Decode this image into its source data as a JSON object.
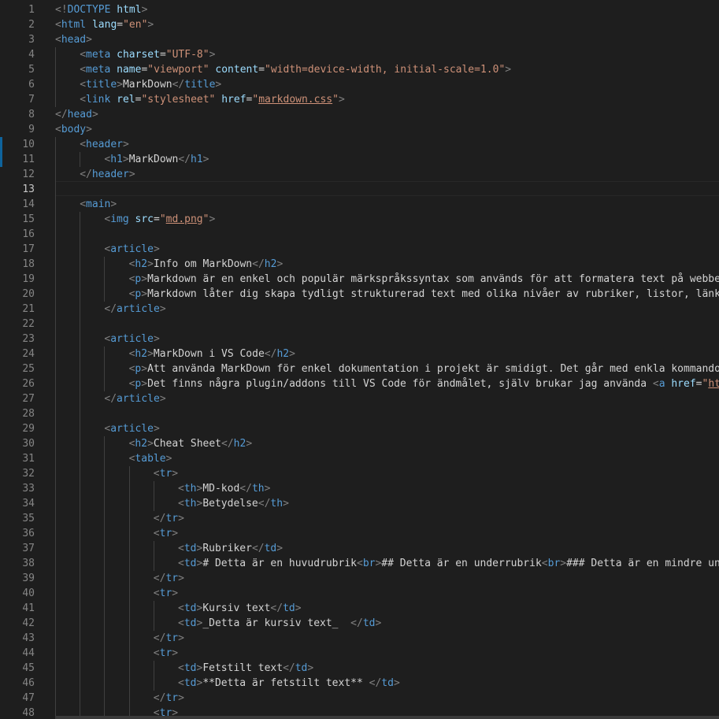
{
  "editor": {
    "language": "html",
    "active_line": 13,
    "lines": [
      {
        "n": 1,
        "indent": 0,
        "t": [
          [
            "bracket",
            "<!"
          ],
          [
            "tag",
            "DOCTYPE"
          ],
          [
            "txt",
            " "
          ],
          [
            "attr",
            "html"
          ],
          [
            "bracket",
            ">"
          ]
        ]
      },
      {
        "n": 2,
        "indent": 0,
        "t": [
          [
            "bracket",
            "<"
          ],
          [
            "tag",
            "html"
          ],
          [
            "txt",
            " "
          ],
          [
            "attr",
            "lang"
          ],
          [
            "eq",
            "="
          ],
          [
            "str",
            "\"en\""
          ],
          [
            "bracket",
            ">"
          ]
        ]
      },
      {
        "n": 3,
        "indent": 0,
        "t": [
          [
            "bracket",
            "<"
          ],
          [
            "tag",
            "head"
          ],
          [
            "bracket",
            ">"
          ]
        ]
      },
      {
        "n": 4,
        "indent": 1,
        "t": [
          [
            "bracket",
            "<"
          ],
          [
            "tag",
            "meta"
          ],
          [
            "txt",
            " "
          ],
          [
            "attr",
            "charset"
          ],
          [
            "eq",
            "="
          ],
          [
            "str",
            "\"UTF-8\""
          ],
          [
            "bracket",
            ">"
          ]
        ]
      },
      {
        "n": 5,
        "indent": 1,
        "t": [
          [
            "bracket",
            "<"
          ],
          [
            "tag",
            "meta"
          ],
          [
            "txt",
            " "
          ],
          [
            "attr",
            "name"
          ],
          [
            "eq",
            "="
          ],
          [
            "str",
            "\"viewport\""
          ],
          [
            "txt",
            " "
          ],
          [
            "attr",
            "content"
          ],
          [
            "eq",
            "="
          ],
          [
            "str",
            "\"width=device-width, initial-scale=1.0\""
          ],
          [
            "bracket",
            ">"
          ]
        ]
      },
      {
        "n": 6,
        "indent": 1,
        "t": [
          [
            "bracket",
            "<"
          ],
          [
            "tag",
            "title"
          ],
          [
            "bracket",
            ">"
          ],
          [
            "txt",
            "MarkDown"
          ],
          [
            "bracket",
            "</"
          ],
          [
            "tag",
            "title"
          ],
          [
            "bracket",
            ">"
          ]
        ]
      },
      {
        "n": 7,
        "indent": 1,
        "t": [
          [
            "bracket",
            "<"
          ],
          [
            "tag",
            "link"
          ],
          [
            "txt",
            " "
          ],
          [
            "attr",
            "rel"
          ],
          [
            "eq",
            "="
          ],
          [
            "str",
            "\"stylesheet\""
          ],
          [
            "txt",
            " "
          ],
          [
            "attr",
            "href"
          ],
          [
            "eq",
            "="
          ],
          [
            "str",
            "\""
          ],
          [
            "str lnk",
            "markdown.css"
          ],
          [
            "str",
            "\""
          ],
          [
            "bracket",
            ">"
          ]
        ]
      },
      {
        "n": 8,
        "indent": 0,
        "t": [
          [
            "bracket",
            "</"
          ],
          [
            "tag",
            "head"
          ],
          [
            "bracket",
            ">"
          ]
        ]
      },
      {
        "n": 9,
        "indent": 0,
        "t": [
          [
            "bracket",
            "<"
          ],
          [
            "tag",
            "body"
          ],
          [
            "bracket",
            ">"
          ]
        ]
      },
      {
        "n": 10,
        "indent": 1,
        "t": [
          [
            "bracket",
            "<"
          ],
          [
            "tag",
            "header"
          ],
          [
            "bracket",
            ">"
          ]
        ]
      },
      {
        "n": 11,
        "indent": 2,
        "t": [
          [
            "bracket",
            "<"
          ],
          [
            "tag",
            "h1"
          ],
          [
            "bracket",
            ">"
          ],
          [
            "txt",
            "MarkDown"
          ],
          [
            "bracket",
            "</"
          ],
          [
            "tag",
            "h1"
          ],
          [
            "bracket",
            ">"
          ]
        ]
      },
      {
        "n": 12,
        "indent": 1,
        "t": [
          [
            "bracket",
            "</"
          ],
          [
            "tag",
            "header"
          ],
          [
            "bracket",
            ">"
          ]
        ]
      },
      {
        "n": 13,
        "indent": 0,
        "t": []
      },
      {
        "n": 14,
        "indent": 1,
        "t": [
          [
            "bracket",
            "<"
          ],
          [
            "tag",
            "main"
          ],
          [
            "bracket",
            ">"
          ]
        ]
      },
      {
        "n": 15,
        "indent": 2,
        "t": [
          [
            "bracket",
            "<"
          ],
          [
            "tag",
            "img"
          ],
          [
            "txt",
            " "
          ],
          [
            "attr",
            "src"
          ],
          [
            "eq",
            "="
          ],
          [
            "str",
            "\""
          ],
          [
            "str lnk",
            "md.png"
          ],
          [
            "str",
            "\""
          ],
          [
            "bracket",
            ">"
          ]
        ]
      },
      {
        "n": 16,
        "indent": 0,
        "t": []
      },
      {
        "n": 17,
        "indent": 2,
        "t": [
          [
            "bracket",
            "<"
          ],
          [
            "tag",
            "article"
          ],
          [
            "bracket",
            ">"
          ]
        ]
      },
      {
        "n": 18,
        "indent": 3,
        "t": [
          [
            "bracket",
            "<"
          ],
          [
            "tag",
            "h2"
          ],
          [
            "bracket",
            ">"
          ],
          [
            "txt",
            "Info om MarkDown"
          ],
          [
            "bracket",
            "</"
          ],
          [
            "tag",
            "h2"
          ],
          [
            "bracket",
            ">"
          ]
        ]
      },
      {
        "n": 19,
        "indent": 3,
        "t": [
          [
            "bracket",
            "<"
          ],
          [
            "tag",
            "p"
          ],
          [
            "bracket",
            ">"
          ],
          [
            "txt",
            "Markdown är en enkel och populär märkspråkssyntax som används för att formatera text på webben."
          ]
        ]
      },
      {
        "n": 20,
        "indent": 3,
        "t": [
          [
            "bracket",
            "<"
          ],
          [
            "tag",
            "p"
          ],
          [
            "bracket",
            ">"
          ],
          [
            "txt",
            "Markdown låter dig skapa tydligt strukturerad text med olika nivåer av rubriker, listor, länkar"
          ]
        ]
      },
      {
        "n": 21,
        "indent": 2,
        "t": [
          [
            "bracket",
            "</"
          ],
          [
            "tag",
            "article"
          ],
          [
            "bracket",
            ">"
          ]
        ]
      },
      {
        "n": 22,
        "indent": 0,
        "t": []
      },
      {
        "n": 23,
        "indent": 2,
        "t": [
          [
            "bracket",
            "<"
          ],
          [
            "tag",
            "article"
          ],
          [
            "bracket",
            ">"
          ]
        ]
      },
      {
        "n": 24,
        "indent": 3,
        "t": [
          [
            "bracket",
            "<"
          ],
          [
            "tag",
            "h2"
          ],
          [
            "bracket",
            ">"
          ],
          [
            "txt",
            "MarkDown i VS Code"
          ],
          [
            "bracket",
            "</"
          ],
          [
            "tag",
            "h2"
          ],
          [
            "bracket",
            ">"
          ]
        ]
      },
      {
        "n": 25,
        "indent": 3,
        "t": [
          [
            "bracket",
            "<"
          ],
          [
            "tag",
            "p"
          ],
          [
            "bracket",
            ">"
          ],
          [
            "txt",
            "Att använda MarkDown för enkel dokumentation i projekt är smidigt. Det går med enkla kommandon"
          ]
        ]
      },
      {
        "n": 26,
        "indent": 3,
        "t": [
          [
            "bracket",
            "<"
          ],
          [
            "tag",
            "p"
          ],
          [
            "bracket",
            ">"
          ],
          [
            "txt",
            "Det finns några plugin/addons till VS Code för ändmålet, själv brukar jag använda "
          ],
          [
            "bracket",
            "<"
          ],
          [
            "tag",
            "a"
          ],
          [
            "txt",
            " "
          ],
          [
            "attr",
            "href"
          ],
          [
            "eq",
            "="
          ],
          [
            "str",
            "\""
          ],
          [
            "str lnk",
            "http"
          ]
        ]
      },
      {
        "n": 27,
        "indent": 2,
        "t": [
          [
            "bracket",
            "</"
          ],
          [
            "tag",
            "article"
          ],
          [
            "bracket",
            ">"
          ]
        ]
      },
      {
        "n": 28,
        "indent": 0,
        "t": []
      },
      {
        "n": 29,
        "indent": 2,
        "t": [
          [
            "bracket",
            "<"
          ],
          [
            "tag",
            "article"
          ],
          [
            "bracket",
            ">"
          ]
        ]
      },
      {
        "n": 30,
        "indent": 3,
        "t": [
          [
            "bracket",
            "<"
          ],
          [
            "tag",
            "h2"
          ],
          [
            "bracket",
            ">"
          ],
          [
            "txt",
            "Cheat Sheet"
          ],
          [
            "bracket",
            "</"
          ],
          [
            "tag",
            "h2"
          ],
          [
            "bracket",
            ">"
          ]
        ]
      },
      {
        "n": 31,
        "indent": 3,
        "t": [
          [
            "bracket",
            "<"
          ],
          [
            "tag",
            "table"
          ],
          [
            "bracket",
            ">"
          ]
        ]
      },
      {
        "n": 32,
        "indent": 4,
        "t": [
          [
            "bracket",
            "<"
          ],
          [
            "tag",
            "tr"
          ],
          [
            "bracket",
            ">"
          ]
        ]
      },
      {
        "n": 33,
        "indent": 5,
        "t": [
          [
            "bracket",
            "<"
          ],
          [
            "tag",
            "th"
          ],
          [
            "bracket",
            ">"
          ],
          [
            "txt",
            "MD-kod"
          ],
          [
            "bracket",
            "</"
          ],
          [
            "tag",
            "th"
          ],
          [
            "bracket",
            ">"
          ]
        ]
      },
      {
        "n": 34,
        "indent": 5,
        "t": [
          [
            "bracket",
            "<"
          ],
          [
            "tag",
            "th"
          ],
          [
            "bracket",
            ">"
          ],
          [
            "txt",
            "Betydelse"
          ],
          [
            "bracket",
            "</"
          ],
          [
            "tag",
            "th"
          ],
          [
            "bracket",
            ">"
          ]
        ]
      },
      {
        "n": 35,
        "indent": 4,
        "t": [
          [
            "bracket",
            "</"
          ],
          [
            "tag",
            "tr"
          ],
          [
            "bracket",
            ">"
          ]
        ]
      },
      {
        "n": 36,
        "indent": 4,
        "t": [
          [
            "bracket",
            "<"
          ],
          [
            "tag",
            "tr"
          ],
          [
            "bracket",
            ">"
          ]
        ]
      },
      {
        "n": 37,
        "indent": 5,
        "t": [
          [
            "bracket",
            "<"
          ],
          [
            "tag",
            "td"
          ],
          [
            "bracket",
            ">"
          ],
          [
            "txt",
            "Rubriker"
          ],
          [
            "bracket",
            "</"
          ],
          [
            "tag",
            "td"
          ],
          [
            "bracket",
            ">"
          ]
        ]
      },
      {
        "n": 38,
        "indent": 5,
        "t": [
          [
            "bracket",
            "<"
          ],
          [
            "tag",
            "td"
          ],
          [
            "bracket",
            ">"
          ],
          [
            "txt",
            "# Detta är en huvudrubrik"
          ],
          [
            "bracket",
            "<"
          ],
          [
            "tag",
            "br"
          ],
          [
            "bracket",
            ">"
          ],
          [
            "txt",
            "## Detta är en underrubrik"
          ],
          [
            "bracket",
            "<"
          ],
          [
            "tag",
            "br"
          ],
          [
            "bracket",
            ">"
          ],
          [
            "txt",
            "### Detta är en mindre unde"
          ]
        ]
      },
      {
        "n": 39,
        "indent": 4,
        "t": [
          [
            "bracket",
            "</"
          ],
          [
            "tag",
            "tr"
          ],
          [
            "bracket",
            ">"
          ]
        ]
      },
      {
        "n": 40,
        "indent": 4,
        "t": [
          [
            "bracket",
            "<"
          ],
          [
            "tag",
            "tr"
          ],
          [
            "bracket",
            ">"
          ]
        ]
      },
      {
        "n": 41,
        "indent": 5,
        "t": [
          [
            "bracket",
            "<"
          ],
          [
            "tag",
            "td"
          ],
          [
            "bracket",
            ">"
          ],
          [
            "txt",
            "Kursiv text"
          ],
          [
            "bracket",
            "</"
          ],
          [
            "tag",
            "td"
          ],
          [
            "bracket",
            ">"
          ]
        ]
      },
      {
        "n": 42,
        "indent": 5,
        "t": [
          [
            "bracket",
            "<"
          ],
          [
            "tag",
            "td"
          ],
          [
            "bracket",
            ">"
          ],
          [
            "txt",
            "_Detta är kursiv text_  "
          ],
          [
            "bracket",
            "</"
          ],
          [
            "tag",
            "td"
          ],
          [
            "bracket",
            ">"
          ]
        ]
      },
      {
        "n": 43,
        "indent": 4,
        "t": [
          [
            "bracket",
            "</"
          ],
          [
            "tag",
            "tr"
          ],
          [
            "bracket",
            ">"
          ]
        ]
      },
      {
        "n": 44,
        "indent": 4,
        "t": [
          [
            "bracket",
            "<"
          ],
          [
            "tag",
            "tr"
          ],
          [
            "bracket",
            ">"
          ]
        ]
      },
      {
        "n": 45,
        "indent": 5,
        "t": [
          [
            "bracket",
            "<"
          ],
          [
            "tag",
            "td"
          ],
          [
            "bracket",
            ">"
          ],
          [
            "txt",
            "Fetstilt text"
          ],
          [
            "bracket",
            "</"
          ],
          [
            "tag",
            "td"
          ],
          [
            "bracket",
            ">"
          ]
        ]
      },
      {
        "n": 46,
        "indent": 5,
        "t": [
          [
            "bracket",
            "<"
          ],
          [
            "tag",
            "td"
          ],
          [
            "bracket",
            ">"
          ],
          [
            "txt",
            "**Detta är fetstilt text** "
          ],
          [
            "bracket",
            "</"
          ],
          [
            "tag",
            "td"
          ],
          [
            "bracket",
            ">"
          ]
        ]
      },
      {
        "n": 47,
        "indent": 4,
        "t": [
          [
            "bracket",
            "</"
          ],
          [
            "tag",
            "tr"
          ],
          [
            "bracket",
            ">"
          ]
        ]
      },
      {
        "n": 48,
        "indent": 4,
        "t": [
          [
            "bracket",
            "<"
          ],
          [
            "tag",
            "tr"
          ],
          [
            "bracket",
            ">"
          ]
        ]
      }
    ]
  }
}
